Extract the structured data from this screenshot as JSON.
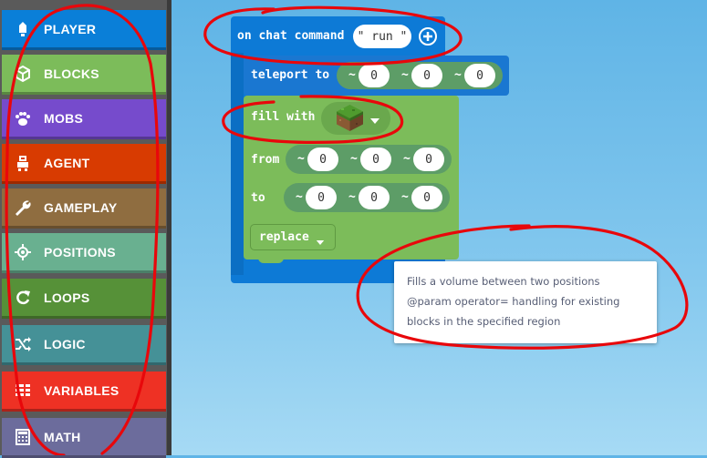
{
  "toolbox": {
    "categories": [
      {
        "label": "PLAYER",
        "icon": "player-icon",
        "color": "#0a7fd8"
      },
      {
        "label": "BLOCKS",
        "icon": "cube-icon",
        "color": "#7cbc5a"
      },
      {
        "label": "MOBS",
        "icon": "paw-icon",
        "color": "#764bcc"
      },
      {
        "label": "AGENT",
        "icon": "agent-icon",
        "color": "#d83b01"
      },
      {
        "label": "GAMEPLAY",
        "icon": "wrench-icon",
        "color": "#8f6d40"
      },
      {
        "label": "POSITIONS",
        "icon": "positions-icon",
        "color": "#69b090"
      },
      {
        "label": "LOOPS",
        "icon": "loop-icon",
        "color": "#569138"
      },
      {
        "label": "LOGIC",
        "icon": "shuffle-icon",
        "color": "#459197"
      },
      {
        "label": "VARIABLES",
        "icon": "variables-icon",
        "color": "#ee3124"
      },
      {
        "label": "MATH",
        "icon": "calculator-icon",
        "color": "#6c6c9c"
      }
    ]
  },
  "workspace": {
    "event_block": {
      "label": "on chat command",
      "command": "\" run \"",
      "color": "#0d7ad6"
    },
    "teleport_block": {
      "label": "teleport to",
      "coords": [
        "~",
        "0",
        "~",
        "0",
        "~",
        "0"
      ],
      "color": "#1a77d1"
    },
    "fill_block": {
      "label": "fill with",
      "from_label": "from",
      "to_label": "to",
      "from_coords": [
        "~",
        "0",
        "~",
        "0",
        "~",
        "0"
      ],
      "to_coords": [
        "~",
        "0",
        "~",
        "0",
        "~",
        "0"
      ],
      "operator": "replace",
      "color": "#7cbc5a"
    },
    "tooltip": "Fills a volume between two positions @param operator= handling for existing blocks in the specified region"
  }
}
